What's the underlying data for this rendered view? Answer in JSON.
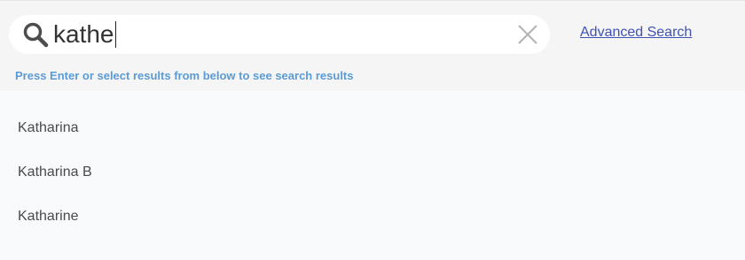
{
  "search": {
    "value": "kathe",
    "advanced_link": "Advanced Search",
    "hint": "Press Enter or select results from below to see search results"
  },
  "results": [
    {
      "label": "Katharina"
    },
    {
      "label": "Katharina B"
    },
    {
      "label": "Katharine"
    }
  ],
  "icons": {
    "search": "search-icon",
    "clear": "close-icon"
  },
  "colors": {
    "link": "#3f51b5",
    "hint": "#5b9bd5",
    "text": "#4a4a4a",
    "header_bg": "#f5f5f5",
    "list_bg": "#f9fafc"
  }
}
